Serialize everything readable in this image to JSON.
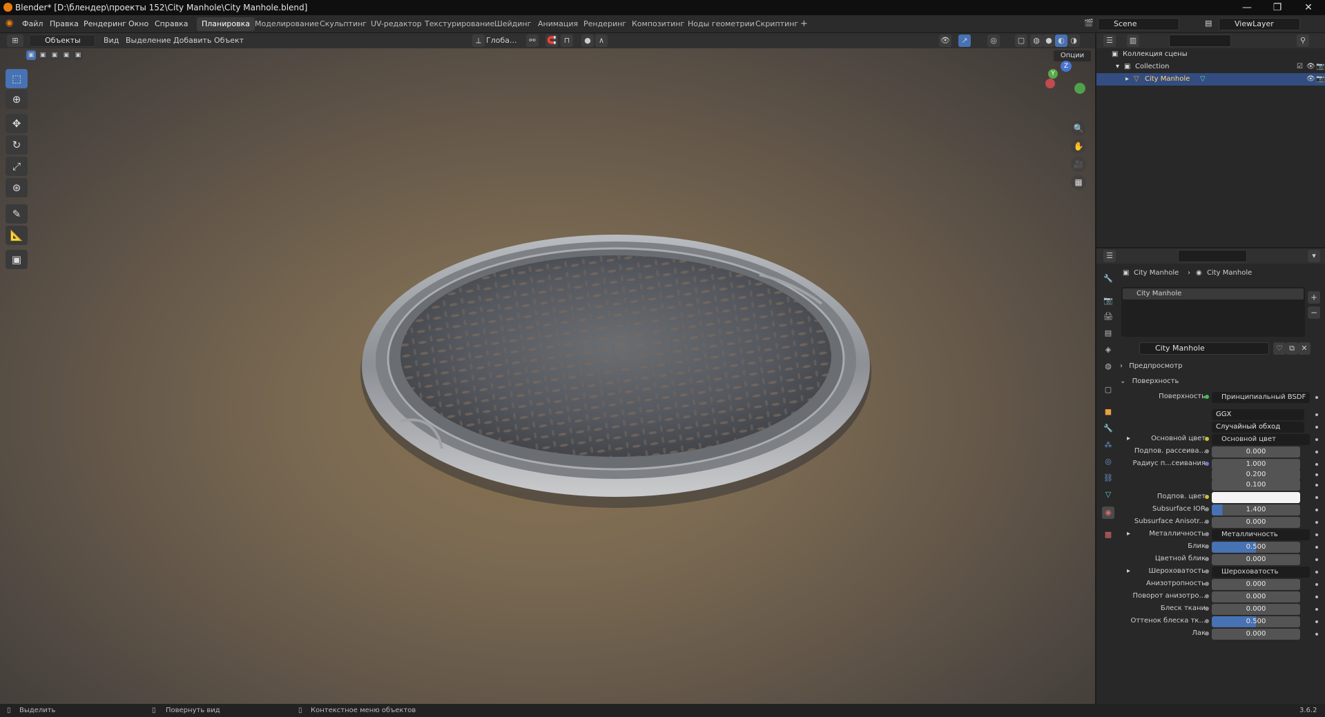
{
  "window": {
    "title": "Blender* [D:\\блендер\\проекты 152\\City Manhole\\City Manhole.blend]",
    "minimize": "—",
    "maximize": "❐",
    "close": "✕"
  },
  "menu": {
    "items": [
      "Файл",
      "Правка",
      "Рендеринг",
      "Окно",
      "Справка"
    ]
  },
  "workspaces": [
    {
      "label": "Планировка",
      "active": true
    },
    {
      "label": "Моделирование",
      "active": false
    },
    {
      "label": "Скульптинг",
      "active": false
    },
    {
      "label": "UV-редактор",
      "active": false
    },
    {
      "label": "Текстурирование",
      "active": false
    },
    {
      "label": "Шейдинг",
      "active": false
    },
    {
      "label": "Анимация",
      "active": false
    },
    {
      "label": "Рендеринг",
      "active": false
    },
    {
      "label": "Композитинг",
      "active": false
    },
    {
      "label": "Ноды геометрии",
      "active": false
    },
    {
      "label": "Скриптинг",
      "active": false
    }
  ],
  "workspace_add": "+",
  "scene": {
    "label": "Scene",
    "view_layer": "ViewLayer"
  },
  "viewport_header": {
    "mode": "Объекты",
    "menus": [
      "Вид",
      "Выделение",
      "Добавить",
      "Объект"
    ],
    "transform_orientation": "Глоба...",
    "options": "Опции"
  },
  "gizmo": {
    "x": "X",
    "y": "Y",
    "z": "Z"
  },
  "outliner": {
    "scene_collection": "Коллекция сцены",
    "collection": "Collection",
    "object": "City Manhole"
  },
  "properties": {
    "breadcrumb_object": "City Manhole",
    "breadcrumb_material": "City Manhole",
    "slot": "City Manhole",
    "material_name": "City Manhole",
    "section_preview": "Предпросмотр",
    "section_surface": "Поверхность",
    "rows": [
      {
        "label": "Поверхность",
        "value": "Принципиальный BSDF",
        "kind": "link",
        "dot": "g"
      },
      {
        "label": "",
        "value": "GGX",
        "kind": "dd",
        "dot": ""
      },
      {
        "label": "",
        "value": "Случайный обход",
        "kind": "dd",
        "dot": ""
      },
      {
        "label": "Основной цвет",
        "value": "Основной цвет",
        "kind": "link",
        "dot": "y",
        "expand": true
      },
      {
        "label": "Подпов. рассеива...",
        "value": "0.000",
        "kind": "num",
        "dot": "n"
      },
      {
        "label": "Радиус п...сеивания",
        "value": "1.000",
        "kind": "num",
        "dot": "b"
      },
      {
        "label": "",
        "value": "0.200",
        "kind": "num",
        "dot": ""
      },
      {
        "label": "",
        "value": "0.100",
        "kind": "num",
        "dot": ""
      },
      {
        "label": "Подпов. цвет",
        "value": "",
        "kind": "white",
        "dot": "y"
      },
      {
        "label": "Subsurface IOR",
        "value": "1.400",
        "kind": "blue1",
        "dot": "n"
      },
      {
        "label": "Subsurface Anisotr...",
        "value": "0.000",
        "kind": "num",
        "dot": "n"
      },
      {
        "label": "Металличность",
        "value": "Металличность",
        "kind": "link",
        "dot": "n",
        "expand": true
      },
      {
        "label": "Блик",
        "value": "0.500",
        "kind": "blue",
        "dot": "n"
      },
      {
        "label": "Цветной блик",
        "value": "0.000",
        "kind": "num",
        "dot": "n"
      },
      {
        "label": "Шероховатость",
        "value": "Шероховатость",
        "kind": "link",
        "dot": "n",
        "expand": true
      },
      {
        "label": "Анизотропность",
        "value": "0.000",
        "kind": "num",
        "dot": "n"
      },
      {
        "label": "Поворот анизотро...",
        "value": "0.000",
        "kind": "num",
        "dot": "n"
      },
      {
        "label": "Блеск ткани",
        "value": "0.000",
        "kind": "num",
        "dot": "n"
      },
      {
        "label": "Оттенок блеска тк...",
        "value": "0.500",
        "kind": "blue",
        "dot": "n"
      },
      {
        "label": "Лак",
        "value": "0.000",
        "kind": "num",
        "dot": "n"
      }
    ]
  },
  "status": {
    "select": "Выделить",
    "rotate": "Повернуть вид",
    "context": "Контекстное меню объектов",
    "version": "3.6.2"
  },
  "colors": {
    "accent": "#4772b3",
    "bg": "#1d1d1d",
    "panel": "#282828"
  }
}
